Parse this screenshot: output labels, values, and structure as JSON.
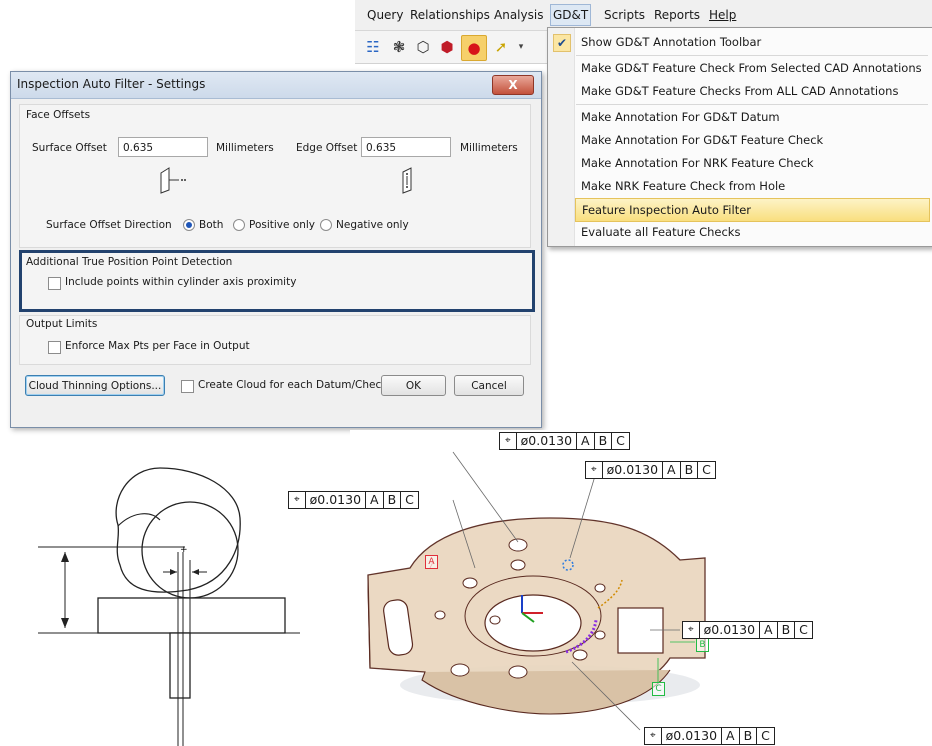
{
  "menubar": {
    "items": [
      "Query",
      "Relationships",
      "Analysis",
      "GD&T",
      "Scripts",
      "Reports",
      "Help"
    ],
    "active": "GD&T"
  },
  "toolbar": {
    "icons": [
      "hierarchy-icon",
      "sphere-grid-icon",
      "cube-icon",
      "red-hexagon-icon",
      "red-sphere-icon",
      "yellow-arrow-icon"
    ]
  },
  "gdt_menu": {
    "items": [
      {
        "label": "Show GD&T Annotation Toolbar",
        "checked": true
      },
      {
        "label": "Make GD&T Feature Check From Selected CAD Annotations"
      },
      {
        "label": "Make GD&T Feature Checks From ALL CAD Annotations"
      },
      {
        "label": "Make Annotation For GD&T Datum"
      },
      {
        "label": "Make Annotation For GD&T Feature Check"
      },
      {
        "label": "Make Annotation For NRK Feature Check"
      },
      {
        "label": "Make NRK Feature Check from Hole"
      },
      {
        "label": "Feature Inspection Auto Filter",
        "highlighted": true
      },
      {
        "label": "Evaluate all Feature Checks"
      }
    ]
  },
  "dialog": {
    "title": "Inspection Auto Filter - Settings",
    "close_label": "X",
    "face_offsets": {
      "title": "Face Offsets",
      "surface_label": "Surface Offset",
      "surface_value": "0.635",
      "surface_unit": "Millimeters",
      "edge_label": "Edge Offset",
      "edge_value": "0.635",
      "edge_unit": "Millimeters",
      "direction_label": "Surface Offset Direction",
      "options": [
        "Both",
        "Positive only",
        "Negative only"
      ],
      "selected": "Both"
    },
    "true_position": {
      "title": "Additional True Position Point Detection",
      "checkbox_label": "Include points within cylinder axis proximity",
      "checked": false
    },
    "output_limits": {
      "title": "Output Limits",
      "checkbox_label": "Enforce Max Pts per Face in Output",
      "checked": false
    },
    "footer": {
      "thinning_button": "Cloud Thinning Options...",
      "create_cloud_label": "Create Cloud for each Datum/Check",
      "create_cloud_checked": false,
      "ok": "OK",
      "cancel": "Cancel"
    }
  },
  "annotations": {
    "position_symbol": "⌖",
    "tolerance": "ø0.0130",
    "datums": [
      "A",
      "B",
      "C"
    ],
    "datum_flags": [
      "A",
      "B",
      "C"
    ]
  },
  "colors": {
    "highlight_box": "#22426e",
    "part_fill": "#e9d9c4",
    "part_edge": "#5a2a20",
    "datum_red": "#e0303a",
    "datum_green": "#22bb44"
  }
}
